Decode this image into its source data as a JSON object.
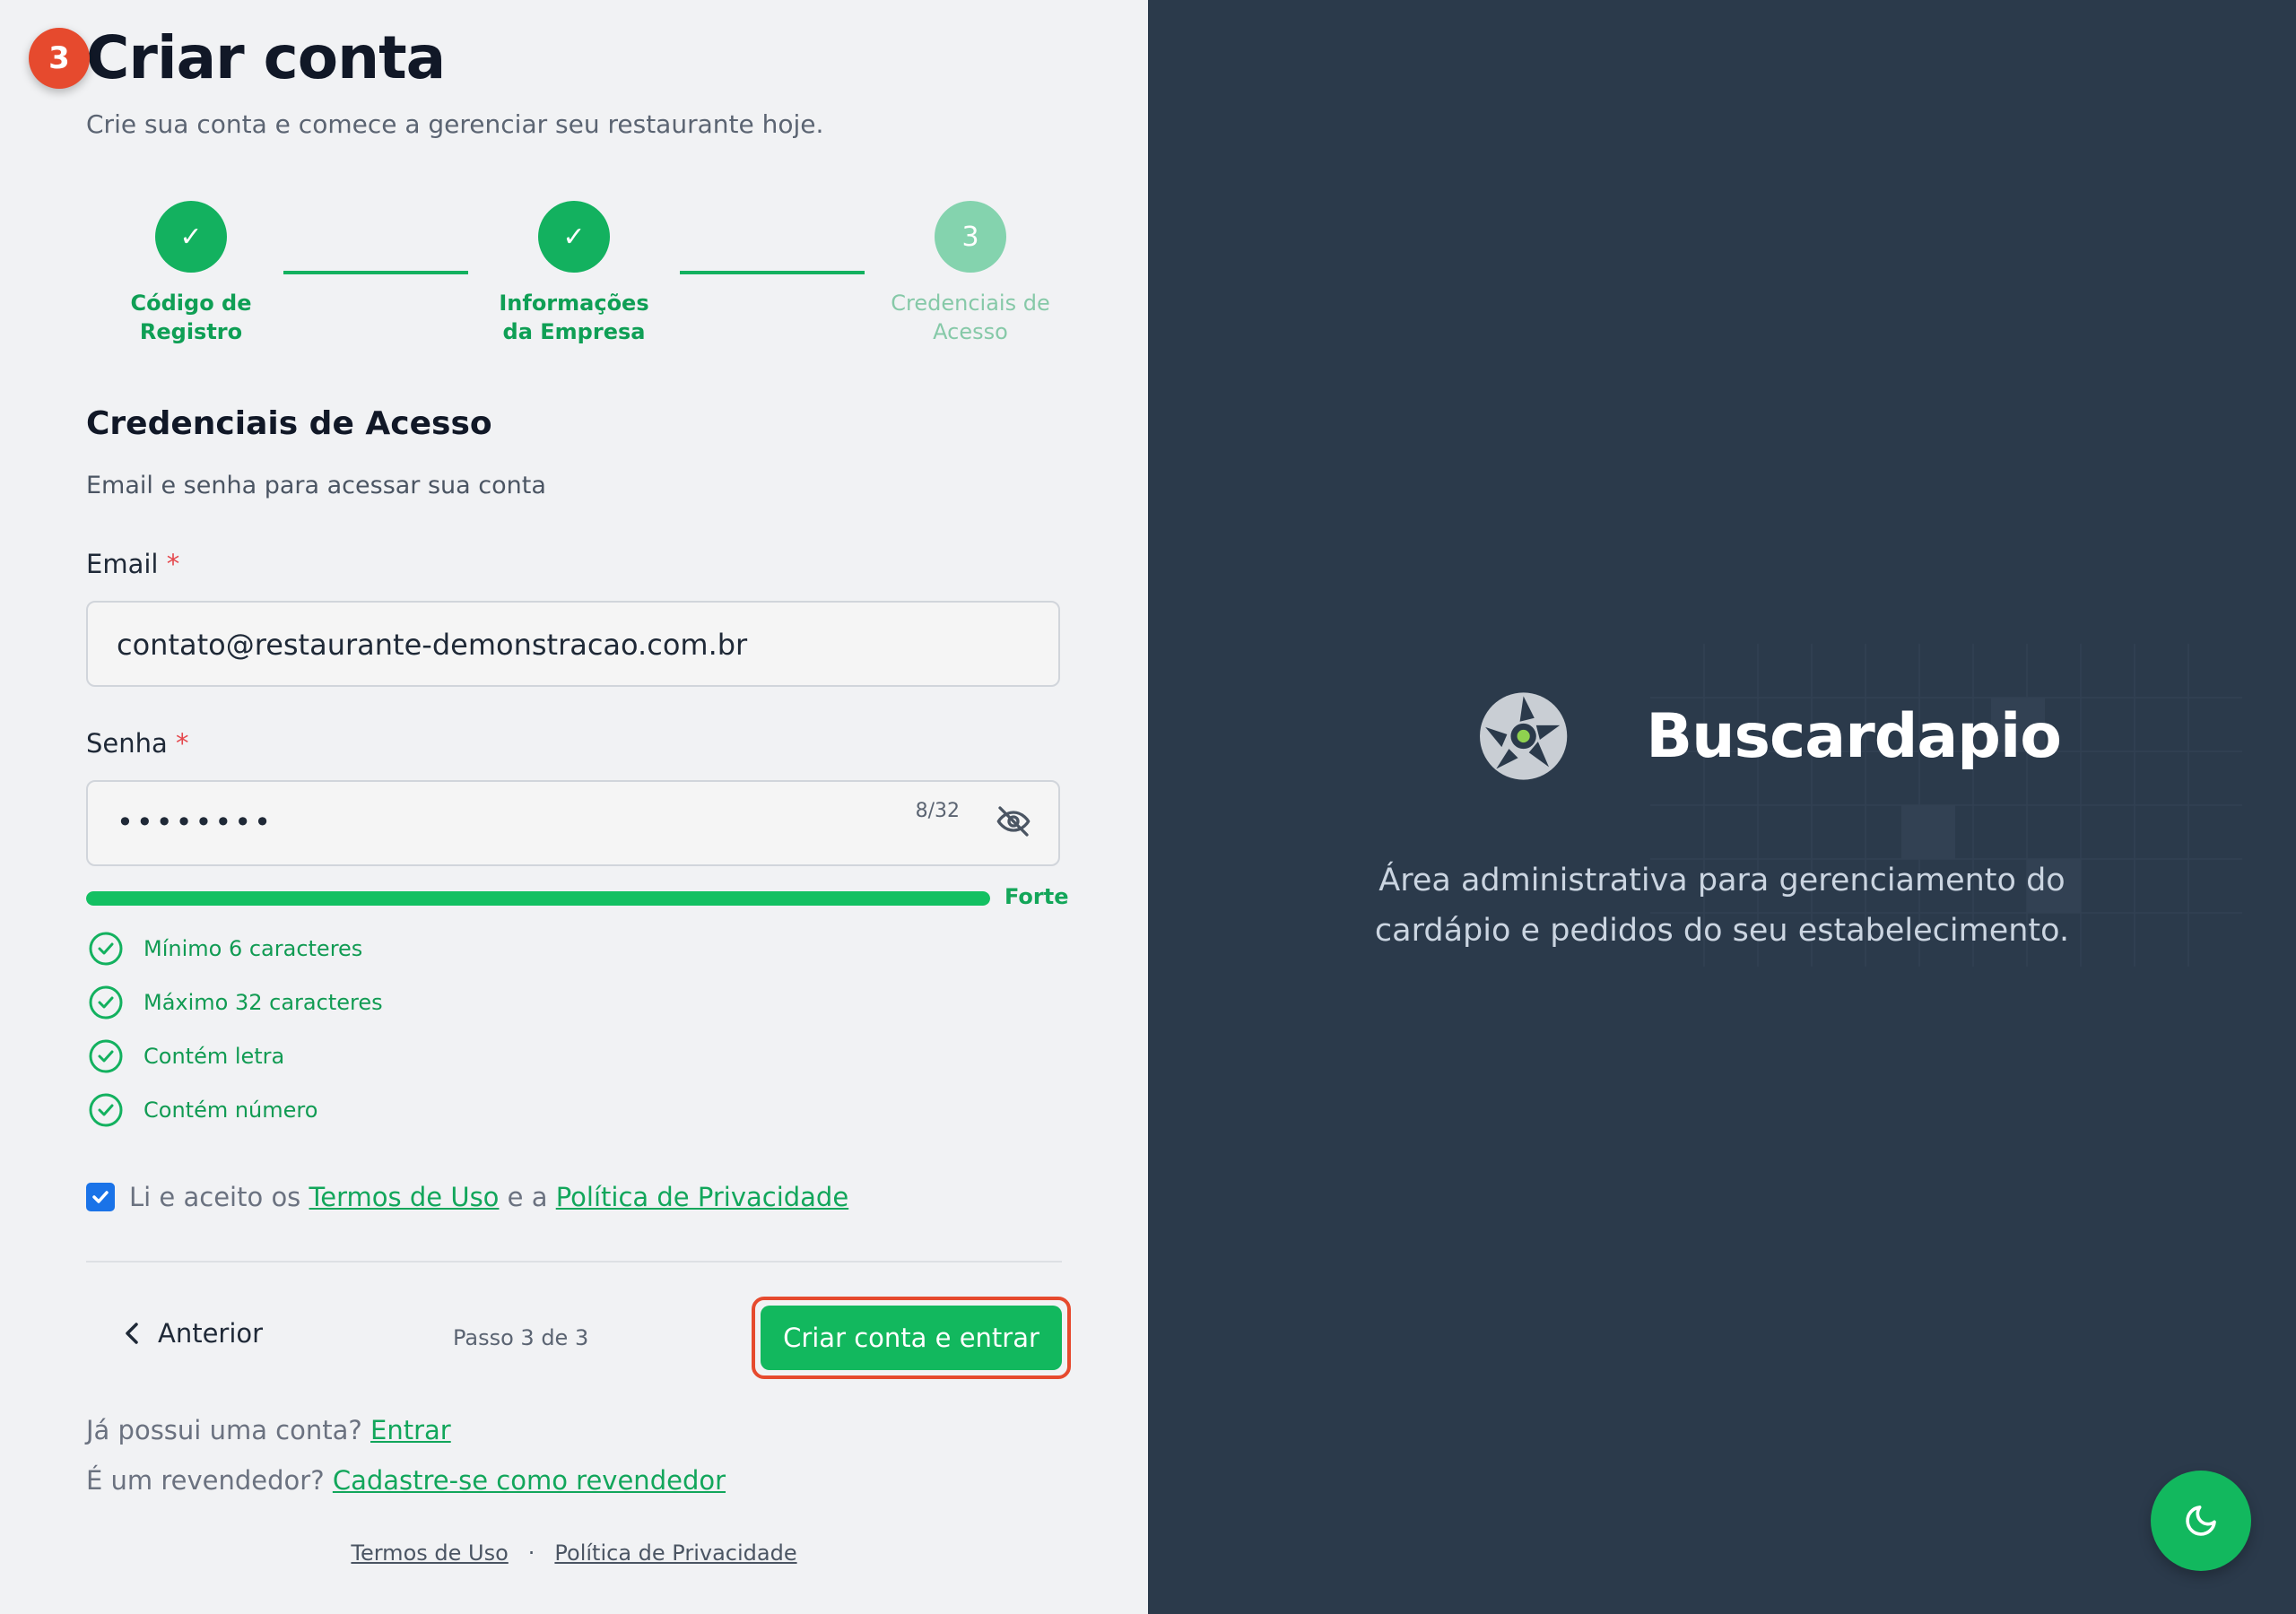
{
  "annotation": {
    "step_number": "3"
  },
  "header": {
    "title": "Criar conta",
    "subtitle": "Crie sua conta e comece a gerenciar seu restaurante hoje."
  },
  "stepper": {
    "steps": [
      {
        "label": "Código de Registro",
        "status": "complete",
        "marker": "✓"
      },
      {
        "label": "Informações da Empresa",
        "status": "complete",
        "marker": "✓"
      },
      {
        "label": "Credenciais de Acesso",
        "status": "current",
        "marker": "3"
      }
    ]
  },
  "section": {
    "title": "Credenciais de Acesso",
    "description": "Email e senha para acessar sua conta"
  },
  "form": {
    "email": {
      "label": "Email",
      "required_mark": "*",
      "value": "contato@restaurante-demonstracao.com.br"
    },
    "password": {
      "label": "Senha",
      "required_mark": "*",
      "masked_value": "••••••••",
      "counter": "8/32"
    },
    "strength": {
      "label": "Forte",
      "fill_fraction": 1.0
    },
    "rules": [
      {
        "text": "Mínimo 6 caracteres",
        "met": true
      },
      {
        "text": "Máximo 32 caracteres",
        "met": true
      },
      {
        "text": "Contém letra",
        "met": true
      },
      {
        "text": "Contém número",
        "met": true
      }
    ],
    "terms": {
      "checked": true,
      "prefix": "Li e aceito os",
      "terms_link": "Termos de Uso",
      "joiner": "e a",
      "privacy_link": "Política de Privacidade"
    }
  },
  "navigation": {
    "back_label": "Anterior",
    "step_counter": "Passo 3 de 3",
    "submit_label": "Criar conta e entrar"
  },
  "alternatives": {
    "login_prompt": "Já possui uma conta?",
    "login_link": "Entrar",
    "reseller_prompt": "É um revendedor?",
    "reseller_link": "Cadastre-se como revendedor"
  },
  "footer": {
    "terms_link": "Termos de Uso",
    "separator": "·",
    "privacy_link": "Política de Privacidade"
  },
  "brand": {
    "name": "Buscardapio",
    "tagline_line1": "Área administrativa para gerenciamento do",
    "tagline_line2": "cardápio e pedidos do seu estabelecimento."
  },
  "icons": {
    "theme_toggle": "moon-icon",
    "password_visibility": "eye-off-icon",
    "back": "chevron-left-icon",
    "rule": "check-circle-icon",
    "brand_logo": "aperture-icon"
  },
  "colors": {
    "accent": "#12b85e",
    "left_bg": "#f1f2f4",
    "right_bg": "#2b3a4b",
    "annotation": "#e64a2e",
    "checkbox": "#1a73e8"
  }
}
